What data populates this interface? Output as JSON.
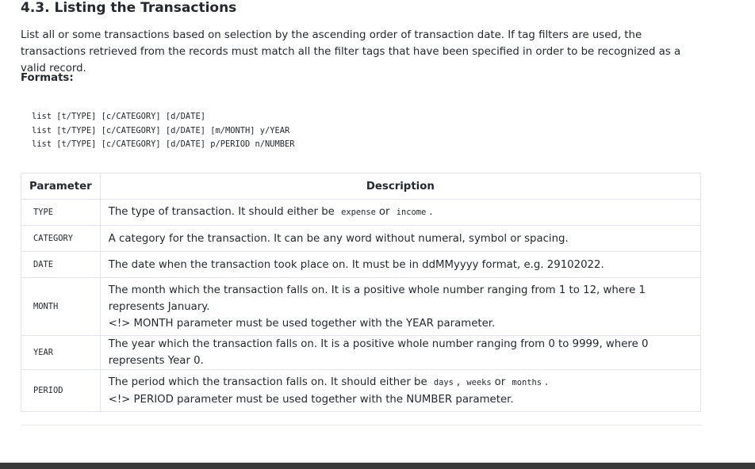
{
  "section": {
    "title": "4.3. Listing the Transactions",
    "description": "List all or some transactions based on selection by the ascending order of transaction date. If tag filters are used, the transactions retrieved from the records must match all the filter tags that have been specified in order to be recognized as a valid record.",
    "formats_label": "Formats:",
    "formats": [
      "list [t/TYPE] [c/CATEGORY] [d/DATE]",
      "list [t/TYPE] [c/CATEGORY] [d/DATE] [m/MONTH] y/YEAR",
      "list [t/TYPE] [c/CATEGORY] [d/DATE] p/PERIOD n/NUMBER"
    ]
  },
  "table": {
    "headers": {
      "parameter": "Parameter",
      "description": "Description"
    },
    "rows": [
      {
        "param": "TYPE",
        "pre": "The type of transaction. It should either be",
        "code1": "expense",
        "mid": "or",
        "code2": "income",
        "post": "."
      },
      {
        "param": "CATEGORY",
        "text": "A category for the transaction. It can be any word without numeral, symbol or spacing."
      },
      {
        "param": "DATE",
        "text": "The date when the transaction took place on. It must be in ddMMyyyy format, e.g. 29102022."
      },
      {
        "param": "MONTH",
        "line1": "The month which the transaction falls on. It is a positive whole number ranging from 1 to 12, where 1 represents January.",
        "note": "<!> MONTH parameter must be used together with the YEAR parameter."
      },
      {
        "param": "YEAR",
        "text": "The year which the transaction falls on. It is a positive whole number ranging from 0 to 9999, where 0 represents Year 0."
      },
      {
        "param": "PERIOD",
        "pre": "The period which the transaction falls on. It should either be",
        "code1": "days",
        "sep": ",",
        "code2": "weeks",
        "mid": "or",
        "code3": "months",
        "post": ".",
        "note": "<!> PERIOD parameter must be used together with the NUMBER parameter."
      }
    ]
  }
}
